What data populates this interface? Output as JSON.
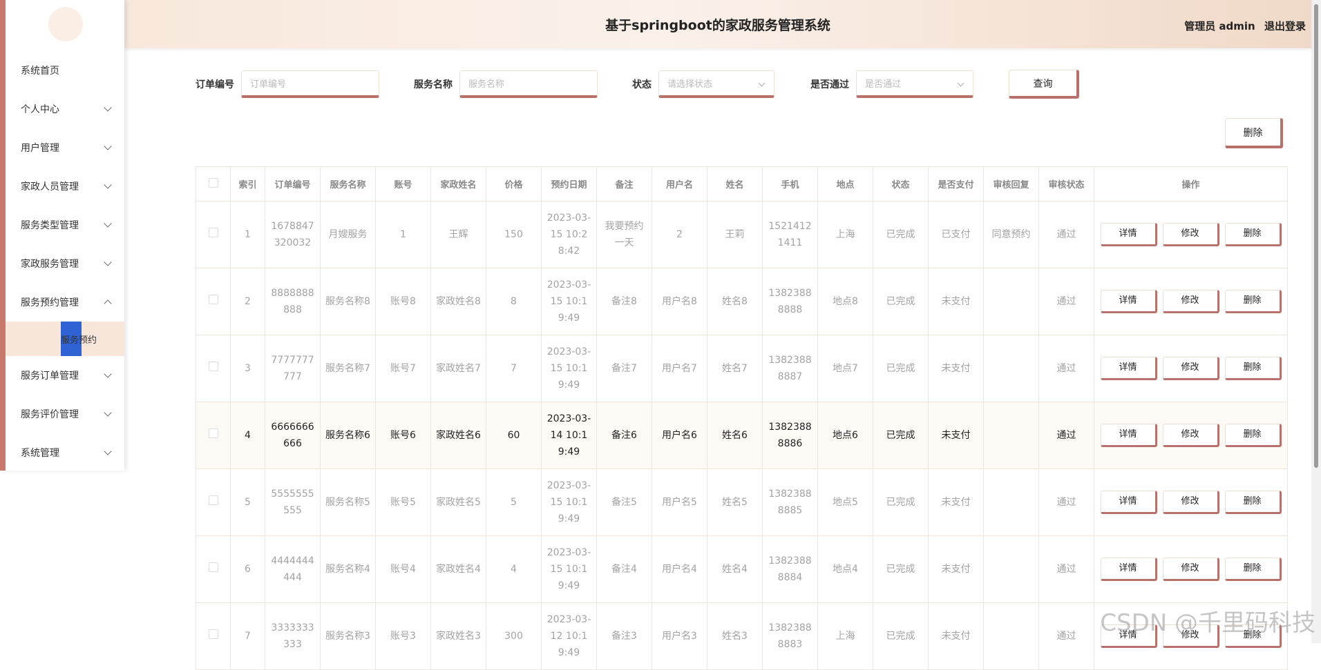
{
  "header": {
    "title": "基于springboot的家政服务管理系统",
    "user": "管理员 admin",
    "logout": "退出登录"
  },
  "sidebar": {
    "items": [
      {
        "label": "系统首页",
        "chevron": "none"
      },
      {
        "label": "个人中心",
        "chevron": "down"
      },
      {
        "label": "用户管理",
        "chevron": "down"
      },
      {
        "label": "家政人员管理",
        "chevron": "down"
      },
      {
        "label": "服务类型管理",
        "chevron": "down"
      },
      {
        "label": "家政服务管理",
        "chevron": "down"
      },
      {
        "label": "服务预约管理",
        "chevron": "up"
      },
      {
        "label": "服务订单管理",
        "chevron": "down"
      },
      {
        "label": "服务评价管理",
        "chevron": "down"
      },
      {
        "label": "系统管理",
        "chevron": "down"
      }
    ],
    "submenu": {
      "label": "服务预约"
    }
  },
  "search": {
    "order_label": "订单编号",
    "order_placeholder": "订单编号",
    "service_label": "服务名称",
    "service_placeholder": "服务名称",
    "status_label": "状态",
    "status_placeholder": "请选择状态",
    "pass_label": "是否通过",
    "pass_placeholder": "是否通过",
    "query_button": "查询"
  },
  "toolbar": {
    "delete_button": "删除"
  },
  "table": {
    "headers": [
      "索引",
      "订单编号",
      "服务名称",
      "账号",
      "家政姓名",
      "价格",
      "预约日期",
      "备注",
      "用户名",
      "姓名",
      "手机",
      "地点",
      "状态",
      "是否支付",
      "审核回复",
      "审核状态",
      "操作"
    ],
    "action_labels": {
      "detail": "详情",
      "edit": "修改",
      "delete": "删除"
    },
    "rows": [
      [
        "1",
        "1678847320032",
        "月嫂服务",
        "1",
        "王辉",
        "150",
        "2023-03-15 10:28:42",
        "我要预约一天",
        "2",
        "王莉",
        "15214121411",
        "上海",
        "已完成",
        "已支付",
        "同意预约",
        "通过"
      ],
      [
        "2",
        "8888888888",
        "服务名称8",
        "账号8",
        "家政姓名8",
        "8",
        "2023-03-15 10:19:49",
        "备注8",
        "用户名8",
        "姓名8",
        "13823888888",
        "地点8",
        "已完成",
        "未支付",
        "",
        "通过"
      ],
      [
        "3",
        "7777777777",
        "服务名称7",
        "账号7",
        "家政姓名7",
        "7",
        "2023-03-15 10:19:49",
        "备注7",
        "用户名7",
        "姓名7",
        "13823888887",
        "地点7",
        "已完成",
        "未支付",
        "",
        "通过"
      ],
      [
        "4",
        "6666666666",
        "服务名称6",
        "账号6",
        "家政姓名6",
        "60",
        "2023-03-14 10:19:49",
        "备注6",
        "用户名6",
        "姓名6",
        "13823888886",
        "地点6",
        "已完成",
        "未支付",
        "",
        "通过"
      ],
      [
        "5",
        "5555555555",
        "服务名称5",
        "账号5",
        "家政姓名5",
        "5",
        "2023-03-15 10:19:49",
        "备注5",
        "用户名5",
        "姓名5",
        "13823888885",
        "地点5",
        "已完成",
        "未支付",
        "",
        "通过"
      ],
      [
        "6",
        "4444444444",
        "服务名称4",
        "账号4",
        "家政姓名4",
        "4",
        "2023-03-15 10:19:49",
        "备注4",
        "用户名4",
        "姓名4",
        "13823888884",
        "地点4",
        "已完成",
        "未支付",
        "",
        "通过"
      ],
      [
        "7",
        "3333333333",
        "服务名称3",
        "账号3",
        "家政姓名3",
        "300",
        "2023-03-12 10:19:49",
        "备注3",
        "用户名3",
        "姓名3",
        "13823888883",
        "上海",
        "已完成",
        "未支付",
        "",
        "通过"
      ]
    ]
  },
  "watermark": "CSDN @千里码科技"
}
